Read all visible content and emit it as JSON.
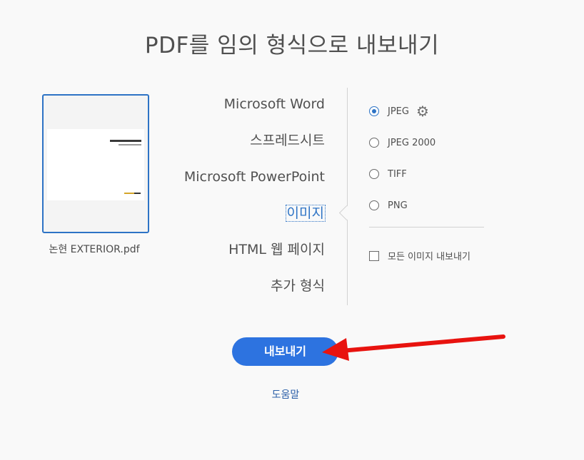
{
  "title": "PDF를 임의 형식으로 내보내기",
  "file": {
    "name": "논현 EXTERIOR.pdf"
  },
  "formats": [
    {
      "label": "Microsoft Word",
      "selected": false
    },
    {
      "label": "스프레드시트",
      "selected": false
    },
    {
      "label": "Microsoft PowerPoint",
      "selected": false
    },
    {
      "label": "이미지",
      "selected": true
    },
    {
      "label": "HTML 웹 페이지",
      "selected": false
    },
    {
      "label": "추가 형식",
      "selected": false
    }
  ],
  "image_options": [
    {
      "label": "JPEG",
      "checked": true,
      "settings_icon": "gear-icon"
    },
    {
      "label": "JPEG 2000",
      "checked": false
    },
    {
      "label": "TIFF",
      "checked": false
    },
    {
      "label": "PNG",
      "checked": false
    }
  ],
  "export_all_images": {
    "label": "모든 이미지 내보내기",
    "checked": false
  },
  "export_button": "내보내기",
  "help_link": "도움말",
  "colors": {
    "accent": "#2d73e0",
    "annotation_arrow": "#e8130f"
  }
}
